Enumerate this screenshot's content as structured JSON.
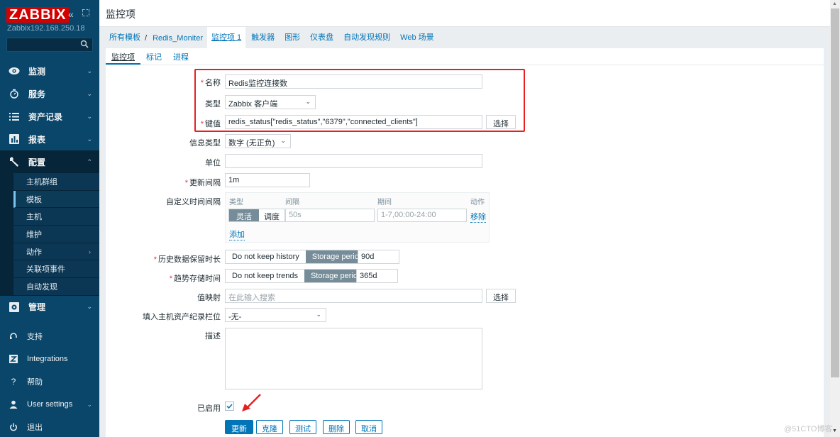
{
  "sidebar": {
    "logo": "ZABBIX",
    "server_name": "Zabbix192.168.250.18",
    "search_placeholder": "",
    "menu": [
      {
        "label": "监测",
        "icon": "eye-icon"
      },
      {
        "label": "服务",
        "icon": "stopwatch-icon"
      },
      {
        "label": "资产记录",
        "icon": "list-icon"
      },
      {
        "label": "报表",
        "icon": "bar-chart-icon"
      },
      {
        "label": "配置",
        "icon": "wrench-icon"
      }
    ],
    "config_sub": [
      "主机群组",
      "模板",
      "主机",
      "维护",
      "动作",
      "关联项事件",
      "自动发现"
    ],
    "admin": {
      "label": "管理",
      "icon": "gear-icon"
    },
    "bottom": [
      {
        "label": "支持",
        "icon": "headset-icon"
      },
      {
        "label": "Integrations",
        "icon": "zabbix-z-icon"
      },
      {
        "label": "帮助",
        "icon": "question-icon"
      },
      {
        "label": "User settings",
        "icon": "user-icon"
      },
      {
        "label": "退出",
        "icon": "power-icon"
      }
    ]
  },
  "header": {
    "title": "监控项"
  },
  "breadcrumb": {
    "all_templates": "所有模板",
    "separator": "/",
    "template": "Redis_Moniter",
    "tabs": [
      "监控项 1",
      "触发器",
      "图形",
      "仪表盘",
      "自动发现规则",
      "Web 场景"
    ]
  },
  "subtabs": [
    "监控项",
    "标记",
    "进程"
  ],
  "form": {
    "name_label": "名称",
    "name_value": "Redis监控连接数",
    "type_label": "类型",
    "type_value": "Zabbix 客户端",
    "key_label": "键值",
    "key_value": "redis_status[\"redis_status\",\"6379\",\"connected_clients\"]",
    "select_label": "选择",
    "info_type_label": "信息类型",
    "info_type_value": "数字 (无正负)",
    "units_label": "单位",
    "units_value": "",
    "interval_label": "更新间隔",
    "interval_value": "1m",
    "custom_label": "自定义时间间隔",
    "custom_headers": [
      "类型",
      "间隔",
      "期间",
      "动作"
    ],
    "custom_type_options": [
      "灵活",
      "调度"
    ],
    "custom_interval": "50s",
    "custom_period": "1-7,00:00-24:00",
    "remove_label": "移除",
    "add_label": "添加",
    "history_label": "历史数据保留时长",
    "history_options": [
      "Do not keep history",
      "Storage period"
    ],
    "history_value": "90d",
    "trends_label": "趋势存储时间",
    "trends_options": [
      "Do not keep trends",
      "Storage period"
    ],
    "trends_value": "365d",
    "valuemap_label": "值映射",
    "valuemap_placeholder": "在此输入搜索",
    "inventory_label": "填入主机资产纪录栏位",
    "inventory_value": "-无-",
    "description_label": "描述",
    "description_value": "",
    "enabled_label": "已启用",
    "enabled": true
  },
  "actions": [
    "更新",
    "克隆",
    "测试",
    "删除",
    "取消"
  ],
  "watermark": "@51CTO博客",
  "colors": {
    "accent": "#0275b8",
    "sidebar": "#0a466a",
    "logo": "#d40000",
    "highlight_box": "#e62020"
  }
}
